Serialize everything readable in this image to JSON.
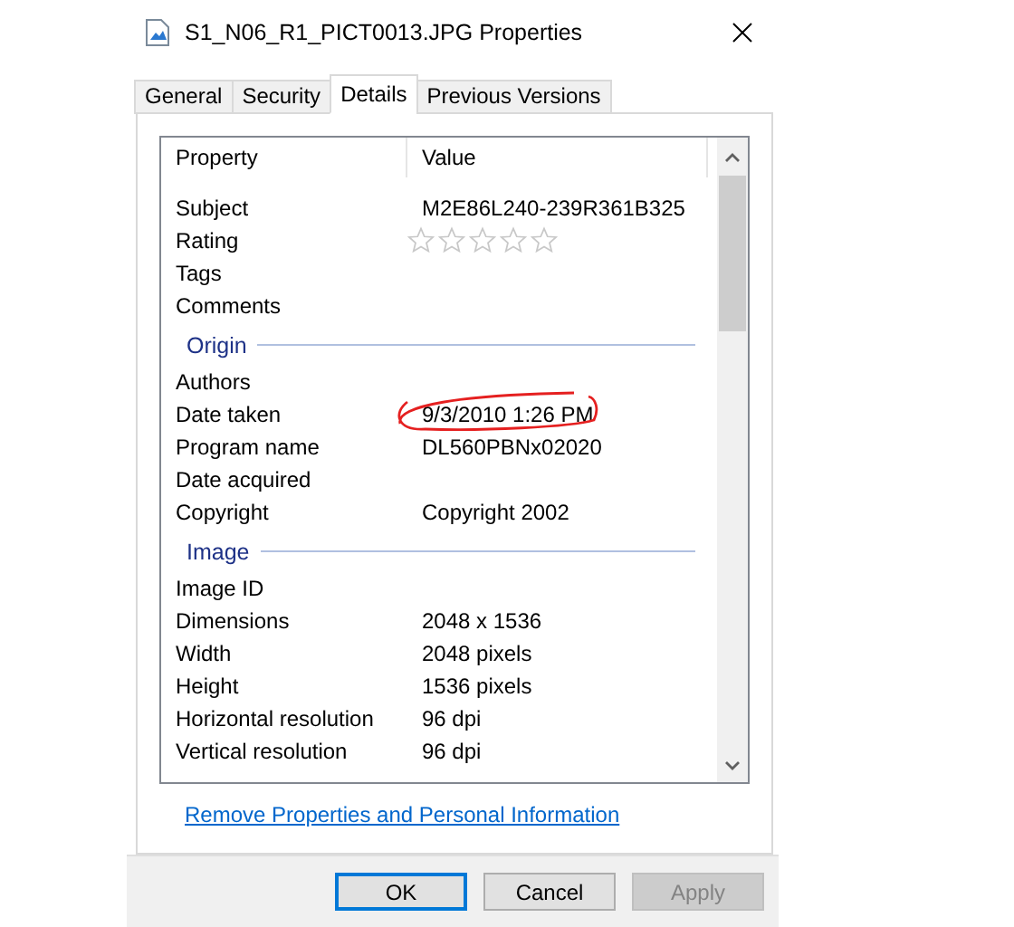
{
  "window": {
    "title": "S1_N06_R1_PICT0013.JPG Properties"
  },
  "tabs": [
    {
      "label": "General",
      "selected": false
    },
    {
      "label": "Security",
      "selected": false
    },
    {
      "label": "Details",
      "selected": true
    },
    {
      "label": "Previous Versions",
      "selected": false
    }
  ],
  "table": {
    "columns": [
      "Property",
      "Value"
    ],
    "rows": [
      {
        "kind": "prop",
        "property": "Subject",
        "value": "M2E86L240-239R361B325"
      },
      {
        "kind": "rating",
        "property": "Rating",
        "stars": 0
      },
      {
        "kind": "prop",
        "property": "Tags",
        "value": ""
      },
      {
        "kind": "prop",
        "property": "Comments",
        "value": ""
      },
      {
        "kind": "group",
        "property": "Origin"
      },
      {
        "kind": "prop",
        "property": "Authors",
        "value": ""
      },
      {
        "kind": "prop",
        "property": "Date taken",
        "value": "9/3/2010 1:26 PM",
        "circled": true
      },
      {
        "kind": "prop",
        "property": "Program name",
        "value": "DL560PBNx02020"
      },
      {
        "kind": "prop",
        "property": "Date acquired",
        "value": ""
      },
      {
        "kind": "prop",
        "property": "Copyright",
        "value": "Copyright 2002"
      },
      {
        "kind": "group",
        "property": "Image"
      },
      {
        "kind": "prop",
        "property": "Image ID",
        "value": ""
      },
      {
        "kind": "prop",
        "property": "Dimensions",
        "value": "2048 x 1536"
      },
      {
        "kind": "prop",
        "property": "Width",
        "value": "2048 pixels"
      },
      {
        "kind": "prop",
        "property": "Height",
        "value": "1536 pixels"
      },
      {
        "kind": "prop",
        "property": "Horizontal resolution",
        "value": "96 dpi"
      },
      {
        "kind": "prop",
        "property": "Vertical resolution",
        "value": "96 dpi"
      }
    ]
  },
  "link": "Remove Properties and Personal Information",
  "buttons": [
    {
      "label": "OK",
      "kind": "default",
      "disabled": false
    },
    {
      "label": "Cancel",
      "kind": "normal",
      "disabled": false
    },
    {
      "label": "Apply",
      "kind": "normal",
      "disabled": true
    }
  ]
}
